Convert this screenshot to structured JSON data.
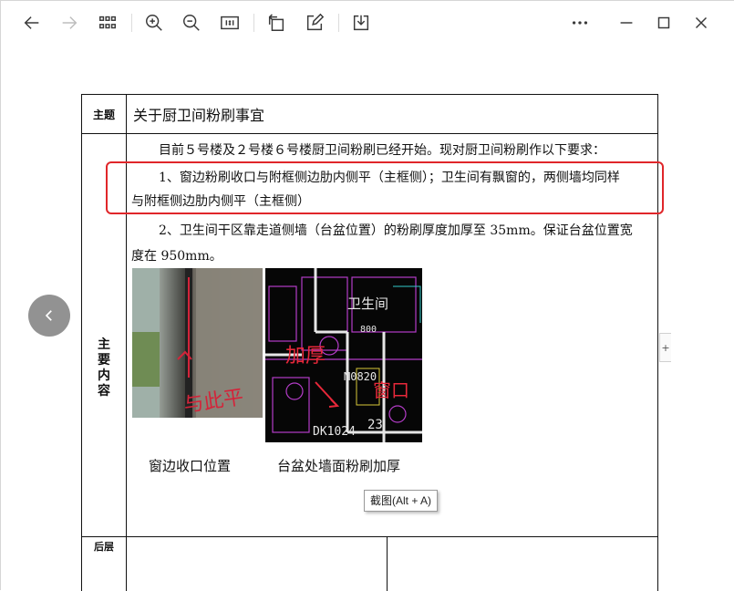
{
  "toolbar": {
    "buttons": [
      {
        "name": "back-button",
        "icon": "arrow-left-icon"
      },
      {
        "name": "forward-button",
        "icon": "arrow-right-icon"
      },
      {
        "name": "thumbnails-button",
        "icon": "grid-icon"
      },
      {
        "name": "zoom-in-button",
        "icon": "zoom-in-icon"
      },
      {
        "name": "zoom-out-button",
        "icon": "zoom-out-icon"
      },
      {
        "name": "actual-size-button",
        "icon": "actual-size-icon",
        "label": "1:1"
      },
      {
        "name": "rotate-button",
        "icon": "rotate-icon"
      },
      {
        "name": "edit-button",
        "icon": "edit-icon"
      },
      {
        "name": "save-button",
        "icon": "download-icon"
      },
      {
        "name": "more-button",
        "icon": "more-icon"
      },
      {
        "name": "minimize-button",
        "icon": "minimize-icon"
      },
      {
        "name": "maximize-button",
        "icon": "maximize-icon"
      },
      {
        "name": "close-button",
        "icon": "close-icon"
      }
    ]
  },
  "document": {
    "subject_label": "主题",
    "subject": "关于厨卫间粉刷事宜",
    "main_label": [
      "主",
      "要",
      "内",
      "容"
    ],
    "paragraphs": {
      "intro": "目前５号楼及２号楼６号楼厨卫间粉刷已经开始。现对厨卫间粉刷作以下要求：",
      "item1_line1": "1、窗边粉刷收口与附框侧边肋内侧平（主框侧）；卫生间有飘窗的，两侧墙均同样",
      "item1_line2": "与附框侧边肋内侧平（主框侧）",
      "item2_line1": "2、卫生间干区靠走道侧墙（台盆位置）的粉刷厚度加厚至 35mm。保证台盆位置宽",
      "item2_line2": "度在 950mm。"
    },
    "captions": {
      "left": "窗边收口位置",
      "right": "台盆处墙面粉刷加厚"
    },
    "photo_annotation": "与此平",
    "drawing": {
      "room_label": "卫生间",
      "annotation_thicken": "加厚",
      "annotation_window": "窗口",
      "label_m0820": "M0820",
      "label_dk": "DK1024",
      "label_800": "800",
      "label_23": "23"
    },
    "bottom_label": "后层"
  },
  "tooltip": "截图(Alt + A)",
  "side_tab": "+",
  "colors": {
    "highlight": "#e0262a",
    "accent_nav": "#6e6e6e"
  }
}
